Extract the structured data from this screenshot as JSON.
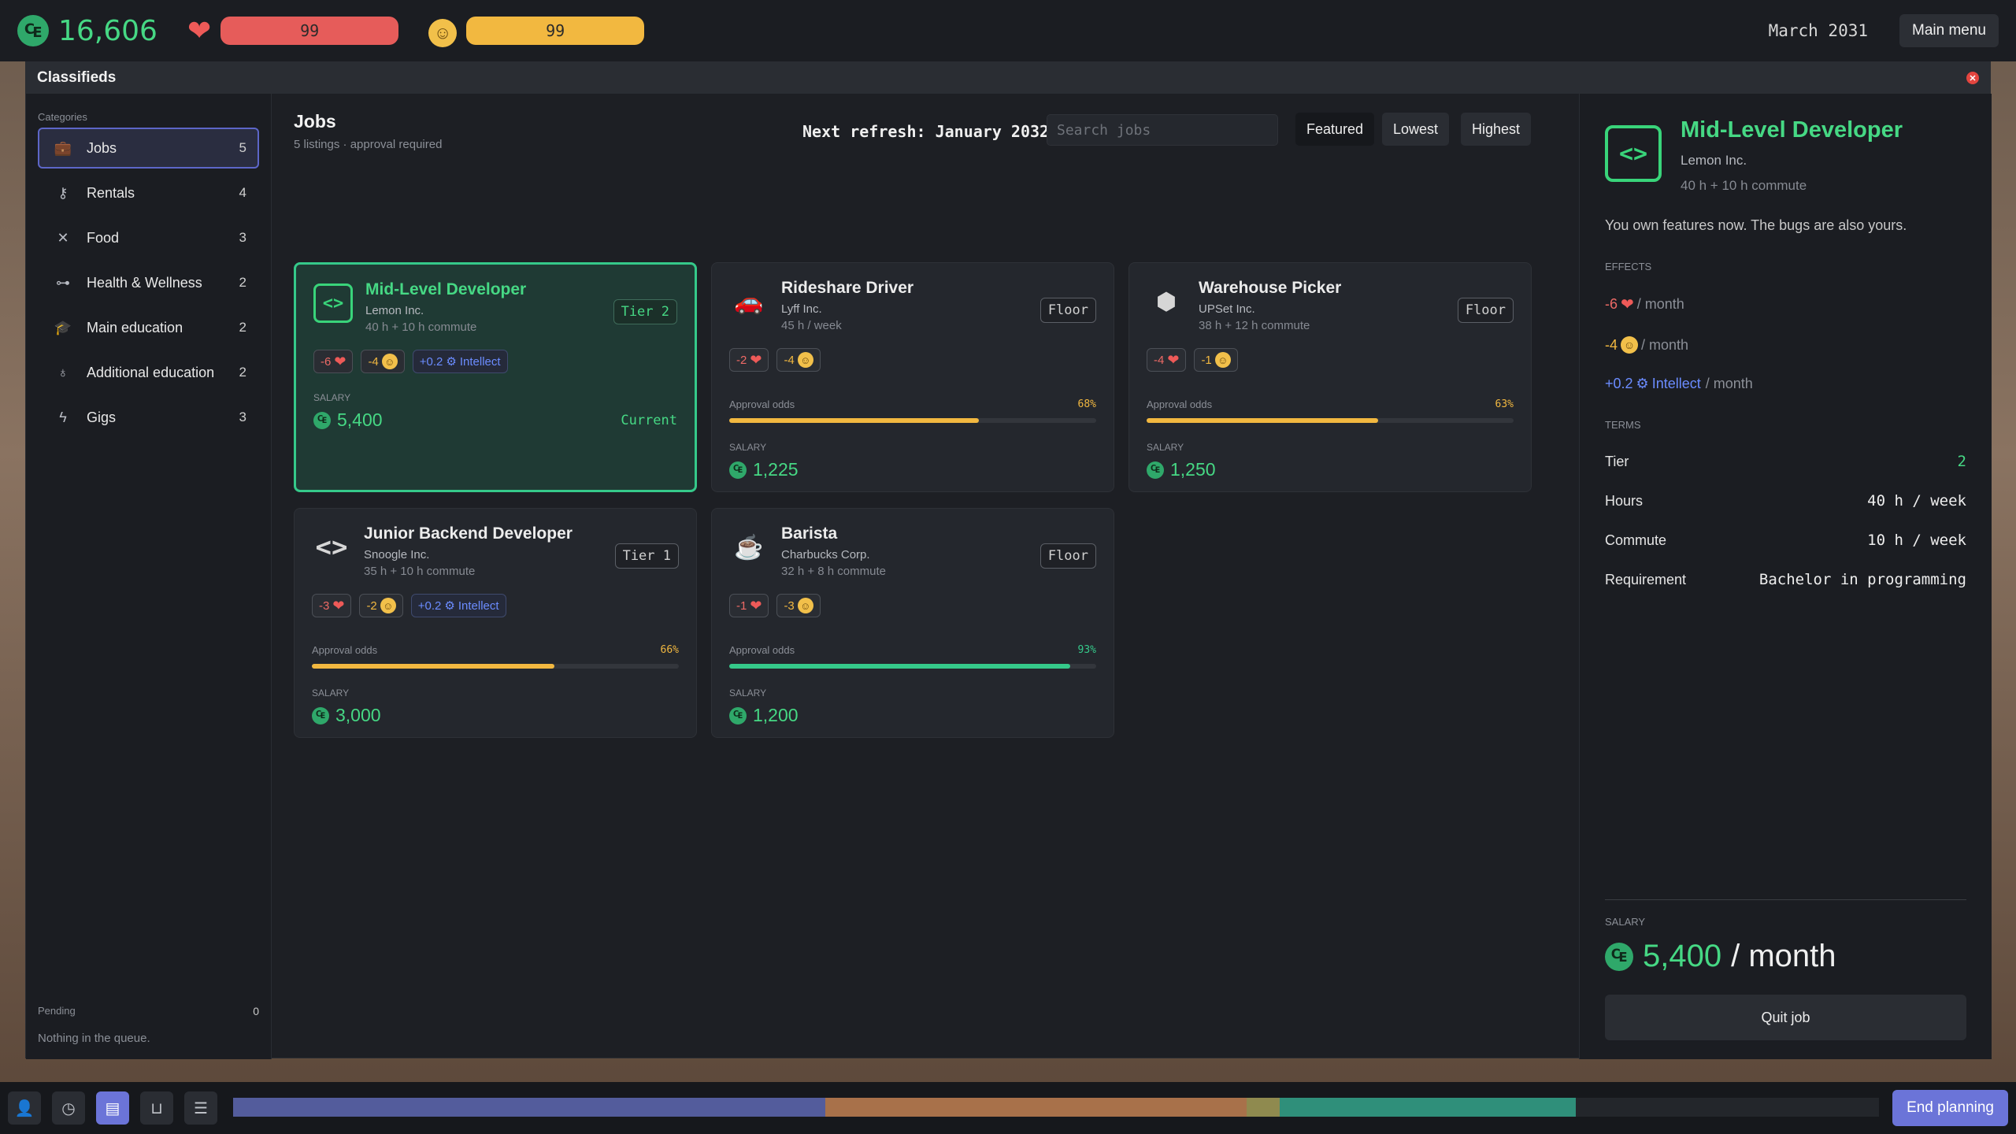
{
  "topbar": {
    "money": "16,606",
    "health": "99",
    "mood": "99",
    "date": "March 2031",
    "main_menu": "Main menu"
  },
  "window": {
    "title": "Classifieds"
  },
  "sidebar": {
    "heading": "Categories",
    "items": [
      {
        "label": "Jobs",
        "count": "5",
        "icon": "briefcase-icon"
      },
      {
        "label": "Rentals",
        "count": "4",
        "icon": "key-icon"
      },
      {
        "label": "Food",
        "count": "3",
        "icon": "utensils-icon"
      },
      {
        "label": "Health & Wellness",
        "count": "2",
        "icon": "dumbbell-icon"
      },
      {
        "label": "Main education",
        "count": "2",
        "icon": "graduation-cap-icon"
      },
      {
        "label": "Additional education",
        "count": "2",
        "icon": "award-icon"
      },
      {
        "label": "Gigs",
        "count": "3",
        "icon": "bolt-icon"
      }
    ],
    "pending_label": "Pending",
    "pending_count": "0",
    "pending_empty": "Nothing in the queue."
  },
  "main": {
    "title": "Jobs",
    "subtitle": "5 listings · approval required",
    "refresh": "Next refresh: January 2032",
    "search_placeholder": "Search jobs",
    "sort": [
      "Featured",
      "Lowest",
      "Highest"
    ]
  },
  "jobs": [
    {
      "title": "Mid-Level Developer",
      "company": "Lemon Inc.",
      "hours": "40 h + 10 h commute",
      "tier": "Tier 2",
      "icon": "code-icon",
      "effects": {
        "health": "-6",
        "mood": "-4",
        "intellect": "+0.2",
        "intellect_label": "Intellect"
      },
      "salary_label": "SALARY",
      "salary": "5,400",
      "current": "Current"
    },
    {
      "title": "Rideshare Driver",
      "company": "Lyff Inc.",
      "hours": "45 h / week",
      "tier": "Floor",
      "icon": "car-icon",
      "effects": {
        "health": "-2",
        "mood": "-4"
      },
      "odds_label": "Approval odds",
      "odds": "68%",
      "odds_value": 0.68,
      "odds_color": "#f2b840",
      "salary_label": "SALARY",
      "salary": "1,225"
    },
    {
      "title": "Warehouse Picker",
      "company": "UPSet Inc.",
      "hours": "38 h + 12 h commute",
      "tier": "Floor",
      "icon": "boxes-icon",
      "effects": {
        "health": "-4",
        "mood": "-1"
      },
      "odds_label": "Approval odds",
      "odds": "63%",
      "odds_value": 0.63,
      "odds_color": "#f2b840",
      "salary_label": "SALARY",
      "salary": "1,250"
    },
    {
      "title": "Junior Backend Developer",
      "company": "Snoogle Inc.",
      "hours": "35 h + 10 h commute",
      "tier": "Tier 1",
      "icon": "code-brackets-icon",
      "effects": {
        "health": "-3",
        "mood": "-2",
        "intellect": "+0.2",
        "intellect_label": "Intellect"
      },
      "odds_label": "Approval odds",
      "odds": "66%",
      "odds_value": 0.66,
      "odds_color": "#f2b840",
      "salary_label": "SALARY",
      "salary": "3,000"
    },
    {
      "title": "Barista",
      "company": "Charbucks Corp.",
      "hours": "32 h + 8 h commute",
      "tier": "Floor",
      "icon": "coffee-cup-icon",
      "effects": {
        "health": "-1",
        "mood": "-3"
      },
      "odds_label": "Approval odds",
      "odds": "93%",
      "odds_value": 0.93,
      "odds_color": "#35c98a",
      "salary_label": "SALARY",
      "salary": "1,200"
    }
  ],
  "detail": {
    "title": "Mid-Level Developer",
    "company": "Lemon Inc.",
    "hours": "40 h + 10 h commute",
    "description": "You own features now. The bugs are also yours.",
    "effects_heading": "EFFECTS",
    "effect_health": "-6",
    "effect_mood": "-4",
    "effect_intellect": "+0.2",
    "intellect_label": "Intellect",
    "per_month": "/ month",
    "terms_heading": "TERMS",
    "terms": [
      {
        "label": "Tier",
        "value": "2"
      },
      {
        "label": "Hours",
        "value": "40 h / week"
      },
      {
        "label": "Commute",
        "value": "10 h / week"
      },
      {
        "label": "Requirement",
        "value": "Bachelor in programming"
      }
    ],
    "salary_label": "SALARY",
    "salary": "5,400",
    "salary_per": "/ month",
    "quit": "Quit job"
  },
  "bottombar": {
    "dock": [
      "person-icon",
      "clock-icon",
      "newspaper-icon",
      "bag-icon",
      "receipt-icon"
    ],
    "timeline": [
      {
        "share": 0.36,
        "color": "#535c9c"
      },
      {
        "share": 0.256,
        "color": "#a8714a"
      },
      {
        "share": 0.02,
        "color": "#8f8a4f"
      },
      {
        "share": 0.18,
        "color": "#2f8f7a"
      },
      {
        "share": 0.184,
        "color": "#23262b"
      }
    ],
    "end_planning": "End planning"
  }
}
